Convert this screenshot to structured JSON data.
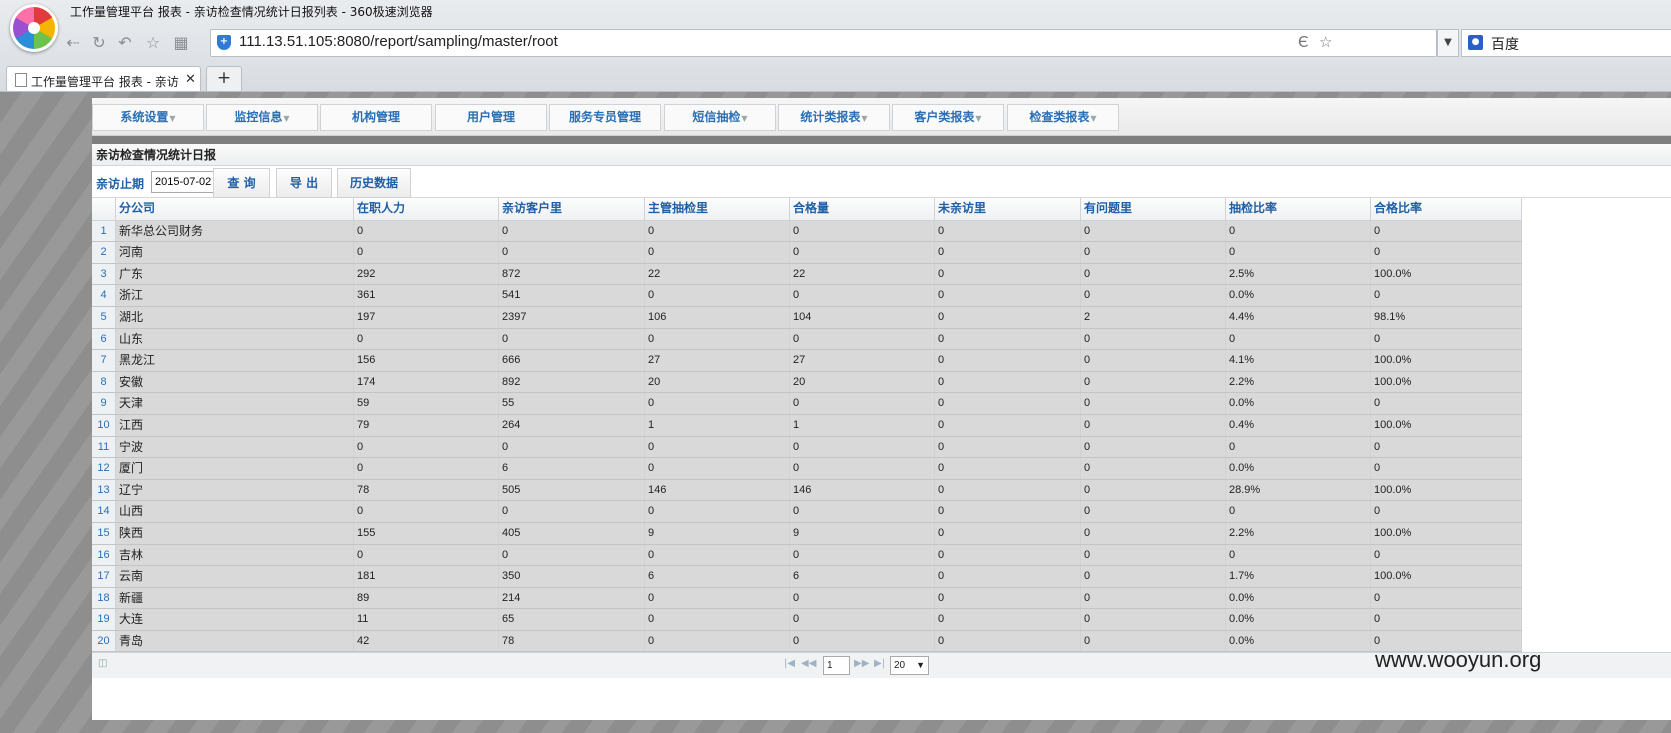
{
  "browser": {
    "window_title": "工作量管理平台 报表 - 亲访检查情况统计日报列表 - 360极速浏览器",
    "url": "111.13.51.105:8080/report/sampling/master/root",
    "search_engine": "百度",
    "tab_title": "工作量管理平台 报表 - 亲访",
    "new_tab": "+"
  },
  "menu": [
    {
      "label": "系统设置",
      "has_dropdown": true
    },
    {
      "label": "监控信息",
      "has_dropdown": true
    },
    {
      "label": "机构管理",
      "has_dropdown": false
    },
    {
      "label": "用户管理",
      "has_dropdown": false
    },
    {
      "label": "服务专员管理",
      "has_dropdown": false
    },
    {
      "label": "短信抽检",
      "has_dropdown": true
    },
    {
      "label": "统计类报表",
      "has_dropdown": true
    },
    {
      "label": "客户类报表",
      "has_dropdown": true
    },
    {
      "label": "检查类报表",
      "has_dropdown": true
    }
  ],
  "panel": {
    "title": "亲访检查情况统计日报",
    "date_label": "亲访止期",
    "date_value": "2015-07-02",
    "query_button": "查 询",
    "export_button": "导 出",
    "history_button": "历史数据"
  },
  "table": {
    "columns": [
      "分公司",
      "在职人力",
      "亲访客户里",
      "主管抽检里",
      "合格量",
      "未亲访里",
      "有问题里",
      "抽检比率",
      "合格比率"
    ],
    "rows": [
      [
        "1",
        "新华总公司财务",
        "0",
        "0",
        "0",
        "0",
        "0",
        "0",
        "0",
        "0"
      ],
      [
        "2",
        "河南",
        "0",
        "0",
        "0",
        "0",
        "0",
        "0",
        "0",
        "0"
      ],
      [
        "3",
        "广东",
        "292",
        "872",
        "22",
        "22",
        "0",
        "0",
        "2.5%",
        "100.0%"
      ],
      [
        "4",
        "浙江",
        "361",
        "541",
        "0",
        "0",
        "0",
        "0",
        "0.0%",
        "0"
      ],
      [
        "5",
        "湖北",
        "197",
        "2397",
        "106",
        "104",
        "0",
        "2",
        "4.4%",
        "98.1%"
      ],
      [
        "6",
        "山东",
        "0",
        "0",
        "0",
        "0",
        "0",
        "0",
        "0",
        "0"
      ],
      [
        "7",
        "黑龙江",
        "156",
        "666",
        "27",
        "27",
        "0",
        "0",
        "4.1%",
        "100.0%"
      ],
      [
        "8",
        "安徽",
        "174",
        "892",
        "20",
        "20",
        "0",
        "0",
        "2.2%",
        "100.0%"
      ],
      [
        "9",
        "天津",
        "59",
        "55",
        "0",
        "0",
        "0",
        "0",
        "0.0%",
        "0"
      ],
      [
        "10",
        "江西",
        "79",
        "264",
        "1",
        "1",
        "0",
        "0",
        "0.4%",
        "100.0%"
      ],
      [
        "11",
        "宁波",
        "0",
        "0",
        "0",
        "0",
        "0",
        "0",
        "0",
        "0"
      ],
      [
        "12",
        "厦门",
        "0",
        "6",
        "0",
        "0",
        "0",
        "0",
        "0.0%",
        "0"
      ],
      [
        "13",
        "辽宁",
        "78",
        "505",
        "146",
        "146",
        "0",
        "0",
        "28.9%",
        "100.0%"
      ],
      [
        "14",
        "山西",
        "0",
        "0",
        "0",
        "0",
        "0",
        "0",
        "0",
        "0"
      ],
      [
        "15",
        "陕西",
        "155",
        "405",
        "9",
        "9",
        "0",
        "0",
        "2.2%",
        "100.0%"
      ],
      [
        "16",
        "吉林",
        "0",
        "0",
        "0",
        "0",
        "0",
        "0",
        "0",
        "0"
      ],
      [
        "17",
        "云南",
        "181",
        "350",
        "6",
        "6",
        "0",
        "0",
        "1.7%",
        "100.0%"
      ],
      [
        "18",
        "新疆",
        "89",
        "214",
        "0",
        "0",
        "0",
        "0",
        "0.0%",
        "0"
      ],
      [
        "19",
        "大连",
        "11",
        "65",
        "0",
        "0",
        "0",
        "0",
        "0.0%",
        "0"
      ],
      [
        "20",
        "青岛",
        "42",
        "78",
        "0",
        "0",
        "0",
        "0",
        "0.0%",
        "0"
      ]
    ]
  },
  "pager": {
    "page": "1",
    "page_size": "20"
  },
  "watermark": "www.wooyun.org"
}
